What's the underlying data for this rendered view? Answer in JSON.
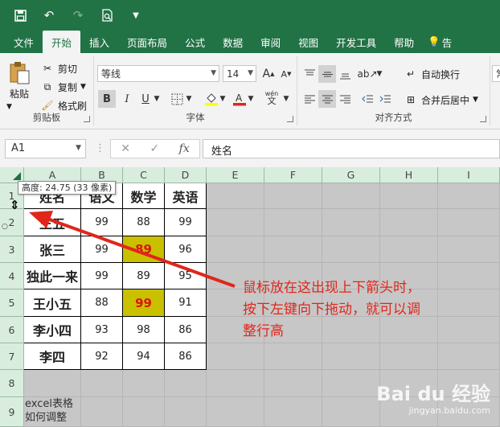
{
  "menu": [
    "文件",
    "开始",
    "插入",
    "页面布局",
    "公式",
    "数据",
    "审阅",
    "视图",
    "开发工具",
    "帮助",
    "告"
  ],
  "ribbon": {
    "paste": "粘贴",
    "cut": "剪切",
    "copy": "复制",
    "format_painter": "格式刷",
    "clipboard_label": "剪贴板",
    "font_name": "等线",
    "font_size": "14",
    "bold": "B",
    "italic": "I",
    "underline": "U",
    "font_label": "字体",
    "wrap_text": "自动换行",
    "merge_center": "合并后居中",
    "align_label": "对齐方式",
    "number_format": "常"
  },
  "formula_bar": {
    "name_box": "A1",
    "formula": "姓名"
  },
  "sheet": {
    "columns": [
      "A",
      "B",
      "C",
      "D",
      "E",
      "F",
      "G",
      "H",
      "I"
    ],
    "rows": [
      "1",
      "2",
      "3",
      "4",
      "5",
      "6",
      "7",
      "8",
      "9"
    ],
    "header": [
      "姓名",
      "语文",
      "数学",
      "英语"
    ],
    "data": [
      [
        "王五",
        "99",
        "88",
        "99"
      ],
      [
        "张三",
        "99",
        "89",
        "96"
      ],
      [
        "独此一来",
        "99",
        "89",
        "95"
      ],
      [
        "王小五",
        "88",
        "99",
        "91"
      ],
      [
        "李小四",
        "93",
        "98",
        "86"
      ],
      [
        "李四",
        "92",
        "94",
        "86"
      ]
    ],
    "note_lines": [
      "excel表格",
      "如何调整"
    ]
  },
  "tooltip": "高度: 24.75 (33 像素)",
  "annotation_lines": [
    "鼠标放在这出现上下箭头时，",
    "按下左键向下拖动，就可以调",
    "整行高"
  ],
  "watermark": {
    "text": "Bai du 经验",
    "sub": "jingyan.baidu.com"
  },
  "colors": {
    "excel_green": "#217346",
    "highlight": "#c9c000",
    "annotation": "#e0261b"
  }
}
